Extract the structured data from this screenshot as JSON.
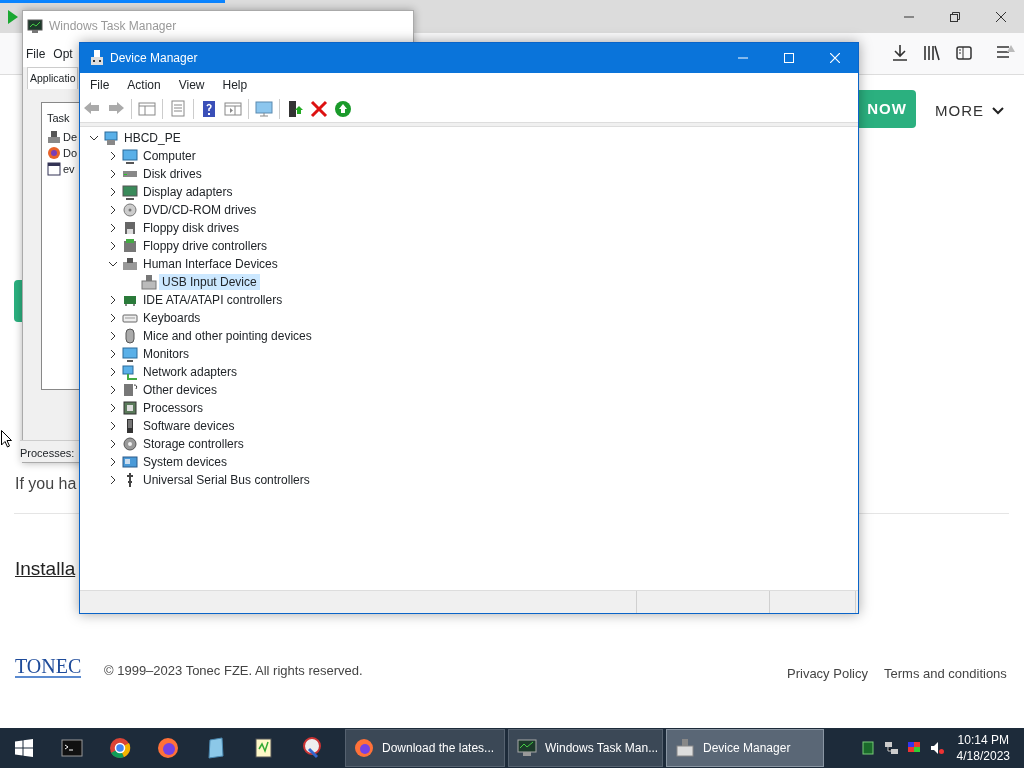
{
  "browser": {
    "page": {
      "cta_button": "NOW",
      "more_menu": "MORE",
      "paragraph": "If you ha",
      "link": "Installa",
      "footer": {
        "logo": "TONEC",
        "copyright": "© 1999–2023 Tonec FZE. All rights reserved.",
        "links": [
          "Privacy Policy",
          "Terms and conditions"
        ]
      }
    }
  },
  "task_manager": {
    "title": "Windows Task Manager",
    "menu": [
      "File",
      "Opt"
    ],
    "tab": "Applicatio",
    "column": "Task",
    "rows": [
      "De",
      "Do",
      "ev"
    ],
    "status": "Processes:"
  },
  "device_manager": {
    "title": "Device Manager",
    "menu": [
      "File",
      "Action",
      "View",
      "Help"
    ],
    "tree": {
      "label": "HBCD_PE",
      "expanded": true,
      "selected": false,
      "children": [
        {
          "label": "Computer",
          "expanded": false,
          "selected": false
        },
        {
          "label": "Disk drives",
          "expanded": false,
          "selected": false
        },
        {
          "label": "Display adapters",
          "expanded": false,
          "selected": false
        },
        {
          "label": "DVD/CD-ROM drives",
          "expanded": false,
          "selected": false
        },
        {
          "label": "Floppy disk drives",
          "expanded": false,
          "selected": false
        },
        {
          "label": "Floppy drive controllers",
          "expanded": false,
          "selected": false
        },
        {
          "label": "Human Interface Devices",
          "expanded": true,
          "selected": false,
          "children": [
            {
              "label": "USB Input Device",
              "selected": true
            }
          ]
        },
        {
          "label": "IDE ATA/ATAPI controllers",
          "expanded": false,
          "selected": false
        },
        {
          "label": "Keyboards",
          "expanded": false,
          "selected": false
        },
        {
          "label": "Mice and other pointing devices",
          "expanded": false,
          "selected": false
        },
        {
          "label": "Monitors",
          "expanded": false,
          "selected": false
        },
        {
          "label": "Network adapters",
          "expanded": false,
          "selected": false
        },
        {
          "label": "Other devices",
          "expanded": false,
          "selected": false
        },
        {
          "label": "Processors",
          "expanded": false,
          "selected": false
        },
        {
          "label": "Software devices",
          "expanded": false,
          "selected": false
        },
        {
          "label": "Storage controllers",
          "expanded": false,
          "selected": false
        },
        {
          "label": "System devices",
          "expanded": false,
          "selected": false
        },
        {
          "label": "Universal Serial Bus controllers",
          "expanded": false,
          "selected": false
        }
      ]
    }
  },
  "taskbar": {
    "windows": [
      {
        "label": "Download the lates...",
        "selected": false
      },
      {
        "label": "Windows Task Man...",
        "selected": false
      },
      {
        "label": "Device Manager",
        "selected": true
      }
    ],
    "clock": {
      "time": "10:14 PM",
      "date": "4/18/2023"
    }
  }
}
